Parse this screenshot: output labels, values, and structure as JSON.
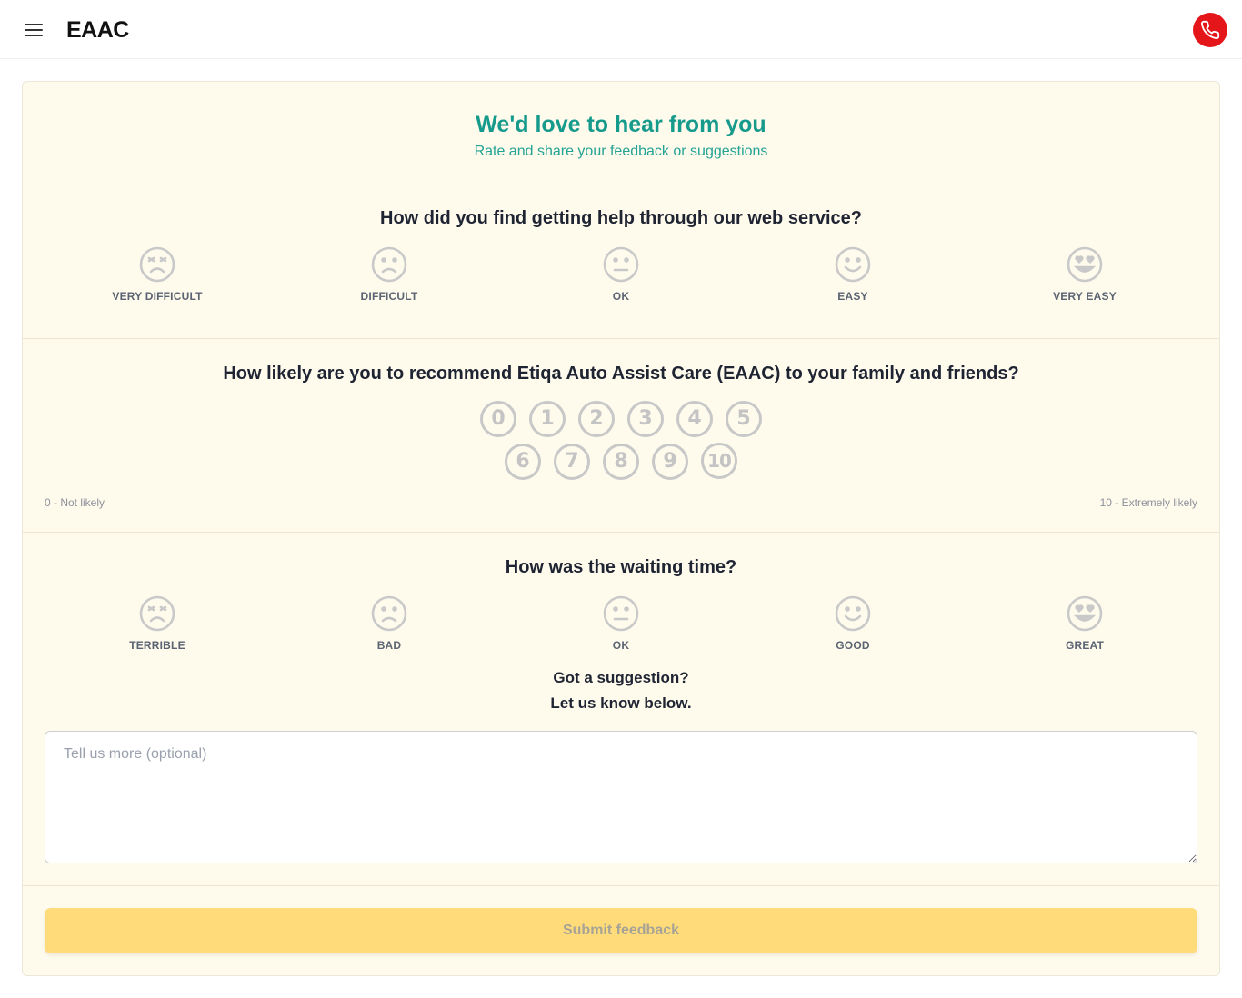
{
  "header": {
    "brand": "EAAC",
    "colors": {
      "call_button": "#e4161a"
    },
    "icons": {
      "menu": "hamburger-menu-icon",
      "call": "phone-icon"
    }
  },
  "feedback": {
    "title": "We'd love to hear from you",
    "subtitle": "Rate and share your feedback or suggestions",
    "q1": {
      "question": "How did you find getting help through our web service?",
      "options": [
        {
          "label": "VERY DIFFICULT",
          "icon": "angry-face-icon"
        },
        {
          "label": "DIFFICULT",
          "icon": "sad-face-icon"
        },
        {
          "label": "OK",
          "icon": "neutral-face-icon"
        },
        {
          "label": "EASY",
          "icon": "smile-face-icon"
        },
        {
          "label": "VERY EASY",
          "icon": "heart-eyes-face-icon"
        }
      ]
    },
    "q2": {
      "question": "How likely are you to recommend Etiqa Auto Assist Care (EAAC) to your family and friends?",
      "scale": [
        "0",
        "1",
        "2",
        "3",
        "4",
        "5",
        "6",
        "7",
        "8",
        "9",
        "10"
      ],
      "low_label": "0 - Not likely",
      "high_label": "10 - Extremely likely"
    },
    "q3": {
      "question": "How was the waiting time?",
      "options": [
        {
          "label": "TERRIBLE",
          "icon": "angry-face-icon"
        },
        {
          "label": "BAD",
          "icon": "sad-face-icon"
        },
        {
          "label": "OK",
          "icon": "neutral-face-icon"
        },
        {
          "label": "GOOD",
          "icon": "smile-face-icon"
        },
        {
          "label": "GREAT",
          "icon": "heart-eyes-face-icon"
        }
      ]
    },
    "suggestion_line1": "Got a suggestion?",
    "suggestion_line2": "Let us know below.",
    "textarea_placeholder": "Tell us more (optional)",
    "submit_label": "Submit feedback",
    "colors": {
      "accent": "#169a8c",
      "card_background": "#fefaec",
      "submit_background": "#ffdb7a"
    }
  }
}
